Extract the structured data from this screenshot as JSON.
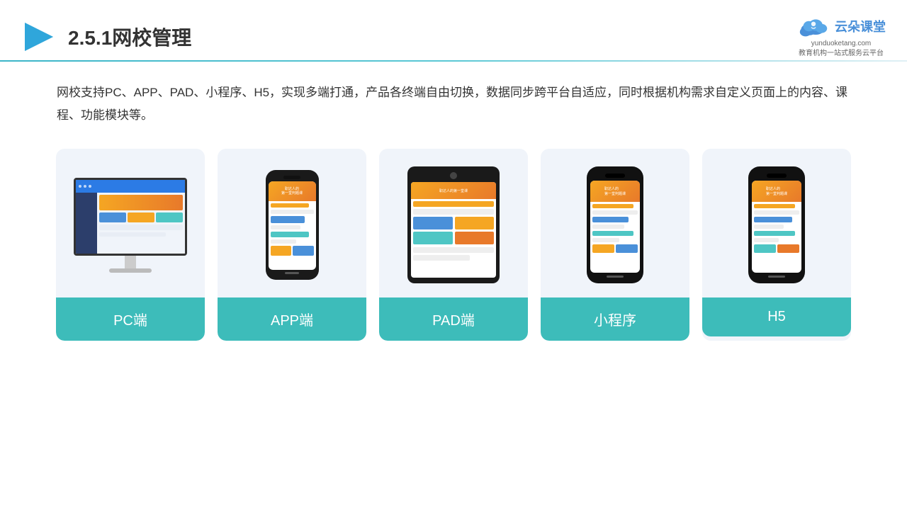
{
  "header": {
    "title": "2.5.1网校管理",
    "brand": {
      "name": "云朵课堂",
      "domain": "yunduoketang.com",
      "tagline": "教育机构一站\n式服务云平台"
    }
  },
  "description": "网校支持PC、APP、PAD、小程序、H5，实现多端打通，产品各终端自由切换，数据同步跨平台自适应，同时根据机构需求自定义页面上的内容、课程、功能模块等。",
  "cards": [
    {
      "id": "pc",
      "label": "PC端"
    },
    {
      "id": "app",
      "label": "APP端"
    },
    {
      "id": "pad",
      "label": "PAD端"
    },
    {
      "id": "miniprogram",
      "label": "小程序"
    },
    {
      "id": "h5",
      "label": "H5"
    }
  ],
  "colors": {
    "teal": "#3dbcba",
    "accent_orange": "#f5a623",
    "accent_blue": "#4a90d9",
    "text_dark": "#333333",
    "bg_card": "#eef2f8"
  }
}
